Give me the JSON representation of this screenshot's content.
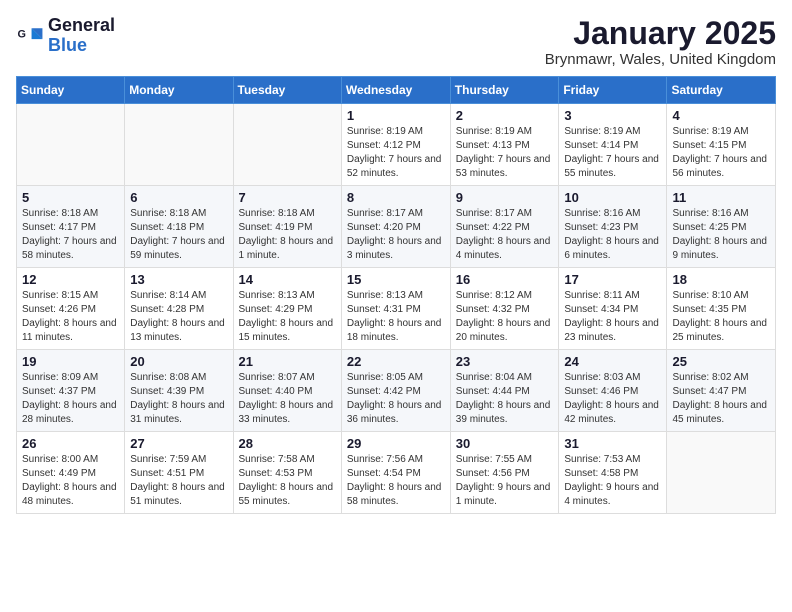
{
  "logo": {
    "general": "General",
    "blue": "Blue"
  },
  "header": {
    "month": "January 2025",
    "location": "Brynmawr, Wales, United Kingdom"
  },
  "weekdays": [
    "Sunday",
    "Monday",
    "Tuesday",
    "Wednesday",
    "Thursday",
    "Friday",
    "Saturday"
  ],
  "weeks": [
    [
      {
        "day": "",
        "sunrise": "",
        "sunset": "",
        "daylight": ""
      },
      {
        "day": "",
        "sunrise": "",
        "sunset": "",
        "daylight": ""
      },
      {
        "day": "",
        "sunrise": "",
        "sunset": "",
        "daylight": ""
      },
      {
        "day": "1",
        "sunrise": "8:19 AM",
        "sunset": "4:12 PM",
        "daylight": "7 hours and 52 minutes."
      },
      {
        "day": "2",
        "sunrise": "8:19 AM",
        "sunset": "4:13 PM",
        "daylight": "7 hours and 53 minutes."
      },
      {
        "day": "3",
        "sunrise": "8:19 AM",
        "sunset": "4:14 PM",
        "daylight": "7 hours and 55 minutes."
      },
      {
        "day": "4",
        "sunrise": "8:19 AM",
        "sunset": "4:15 PM",
        "daylight": "7 hours and 56 minutes."
      }
    ],
    [
      {
        "day": "5",
        "sunrise": "8:18 AM",
        "sunset": "4:17 PM",
        "daylight": "7 hours and 58 minutes."
      },
      {
        "day": "6",
        "sunrise": "8:18 AM",
        "sunset": "4:18 PM",
        "daylight": "7 hours and 59 minutes."
      },
      {
        "day": "7",
        "sunrise": "8:18 AM",
        "sunset": "4:19 PM",
        "daylight": "8 hours and 1 minute."
      },
      {
        "day": "8",
        "sunrise": "8:17 AM",
        "sunset": "4:20 PM",
        "daylight": "8 hours and 3 minutes."
      },
      {
        "day": "9",
        "sunrise": "8:17 AM",
        "sunset": "4:22 PM",
        "daylight": "8 hours and 4 minutes."
      },
      {
        "day": "10",
        "sunrise": "8:16 AM",
        "sunset": "4:23 PM",
        "daylight": "8 hours and 6 minutes."
      },
      {
        "day": "11",
        "sunrise": "8:16 AM",
        "sunset": "4:25 PM",
        "daylight": "8 hours and 9 minutes."
      }
    ],
    [
      {
        "day": "12",
        "sunrise": "8:15 AM",
        "sunset": "4:26 PM",
        "daylight": "8 hours and 11 minutes."
      },
      {
        "day": "13",
        "sunrise": "8:14 AM",
        "sunset": "4:28 PM",
        "daylight": "8 hours and 13 minutes."
      },
      {
        "day": "14",
        "sunrise": "8:13 AM",
        "sunset": "4:29 PM",
        "daylight": "8 hours and 15 minutes."
      },
      {
        "day": "15",
        "sunrise": "8:13 AM",
        "sunset": "4:31 PM",
        "daylight": "8 hours and 18 minutes."
      },
      {
        "day": "16",
        "sunrise": "8:12 AM",
        "sunset": "4:32 PM",
        "daylight": "8 hours and 20 minutes."
      },
      {
        "day": "17",
        "sunrise": "8:11 AM",
        "sunset": "4:34 PM",
        "daylight": "8 hours and 23 minutes."
      },
      {
        "day": "18",
        "sunrise": "8:10 AM",
        "sunset": "4:35 PM",
        "daylight": "8 hours and 25 minutes."
      }
    ],
    [
      {
        "day": "19",
        "sunrise": "8:09 AM",
        "sunset": "4:37 PM",
        "daylight": "8 hours and 28 minutes."
      },
      {
        "day": "20",
        "sunrise": "8:08 AM",
        "sunset": "4:39 PM",
        "daylight": "8 hours and 31 minutes."
      },
      {
        "day": "21",
        "sunrise": "8:07 AM",
        "sunset": "4:40 PM",
        "daylight": "8 hours and 33 minutes."
      },
      {
        "day": "22",
        "sunrise": "8:05 AM",
        "sunset": "4:42 PM",
        "daylight": "8 hours and 36 minutes."
      },
      {
        "day": "23",
        "sunrise": "8:04 AM",
        "sunset": "4:44 PM",
        "daylight": "8 hours and 39 minutes."
      },
      {
        "day": "24",
        "sunrise": "8:03 AM",
        "sunset": "4:46 PM",
        "daylight": "8 hours and 42 minutes."
      },
      {
        "day": "25",
        "sunrise": "8:02 AM",
        "sunset": "4:47 PM",
        "daylight": "8 hours and 45 minutes."
      }
    ],
    [
      {
        "day": "26",
        "sunrise": "8:00 AM",
        "sunset": "4:49 PM",
        "daylight": "8 hours and 48 minutes."
      },
      {
        "day": "27",
        "sunrise": "7:59 AM",
        "sunset": "4:51 PM",
        "daylight": "8 hours and 51 minutes."
      },
      {
        "day": "28",
        "sunrise": "7:58 AM",
        "sunset": "4:53 PM",
        "daylight": "8 hours and 55 minutes."
      },
      {
        "day": "29",
        "sunrise": "7:56 AM",
        "sunset": "4:54 PM",
        "daylight": "8 hours and 58 minutes."
      },
      {
        "day": "30",
        "sunrise": "7:55 AM",
        "sunset": "4:56 PM",
        "daylight": "9 hours and 1 minute."
      },
      {
        "day": "31",
        "sunrise": "7:53 AM",
        "sunset": "4:58 PM",
        "daylight": "9 hours and 4 minutes."
      },
      {
        "day": "",
        "sunrise": "",
        "sunset": "",
        "daylight": ""
      }
    ]
  ]
}
